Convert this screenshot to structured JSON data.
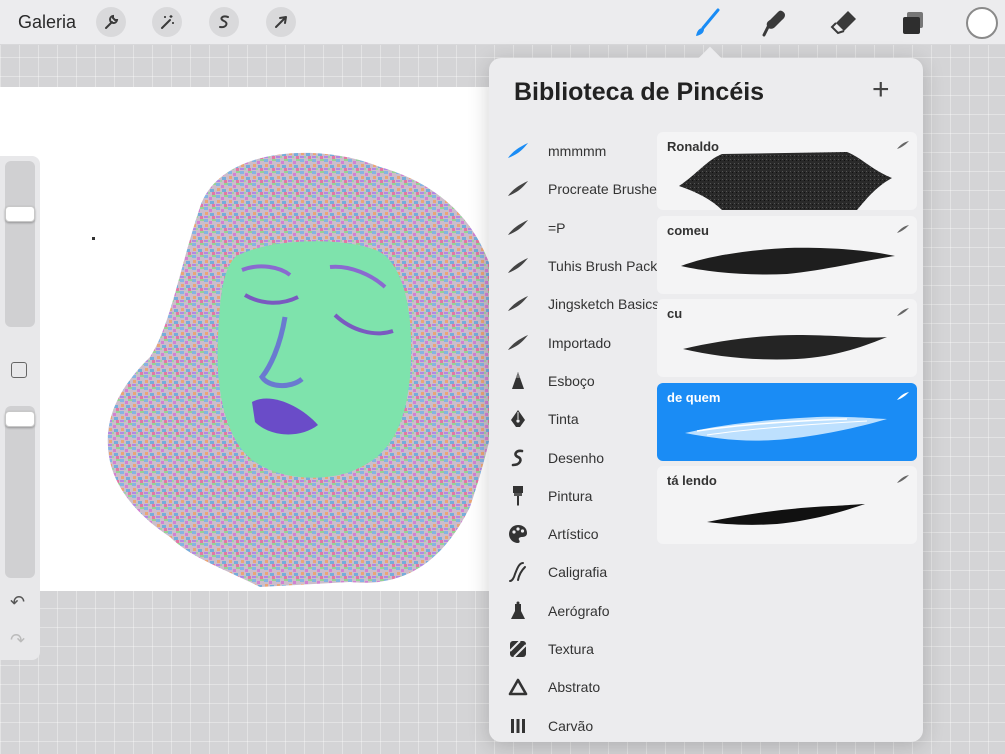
{
  "topbar": {
    "gallery_label": "Galeria",
    "left_tools": [
      "wrench-icon",
      "magic-wand-icon",
      "selection-icon",
      "transform-arrow-icon"
    ],
    "right_tools": [
      "brush-icon",
      "smudge-icon",
      "eraser-icon",
      "layers-icon"
    ],
    "active_tool": "brush-icon",
    "active_color": "#1a8cf5",
    "current_color": "#ffffff"
  },
  "panel": {
    "title": "Biblioteca de Pincéis",
    "add_label": "+",
    "brush_sets": [
      {
        "label": "mmmmm",
        "icon": "brush-stroke-icon",
        "active": true
      },
      {
        "label": "Procreate Brushes",
        "icon": "brush-stroke-icon"
      },
      {
        "label": "=P",
        "icon": "brush-stroke-icon"
      },
      {
        "label": "Tuhis Brush Pack",
        "icon": "brush-stroke-icon"
      },
      {
        "label": "Jingsketch Basics",
        "icon": "brush-stroke-icon"
      },
      {
        "label": "Importado",
        "icon": "brush-stroke-icon"
      },
      {
        "label": "Esboço",
        "icon": "pencil-tip-icon"
      },
      {
        "label": "Tinta",
        "icon": "pen-nib-icon"
      },
      {
        "label": "Desenho",
        "icon": "squiggle-icon"
      },
      {
        "label": "Pintura",
        "icon": "paintbrush-icon"
      },
      {
        "label": "Artístico",
        "icon": "palette-icon"
      },
      {
        "label": "Caligrafia",
        "icon": "calligraphy-icon"
      },
      {
        "label": "Aerógrafo",
        "icon": "airbrush-icon"
      },
      {
        "label": "Textura",
        "icon": "texture-icon"
      },
      {
        "label": "Abstrato",
        "icon": "triangle-icon"
      },
      {
        "label": "Carvão",
        "icon": "charcoal-icon"
      }
    ],
    "brushes": [
      {
        "name": "Ronaldo",
        "stroke": "texture-blob"
      },
      {
        "name": "comeu",
        "stroke": "rough-taper"
      },
      {
        "name": "cu",
        "stroke": "smooth-taper"
      },
      {
        "name": "de quem",
        "stroke": "glow-streak",
        "selected": true
      },
      {
        "name": "tá lendo",
        "stroke": "thin-taper"
      }
    ]
  },
  "sidebar": {
    "brush_size": 0.3,
    "opacity": 0.97
  }
}
